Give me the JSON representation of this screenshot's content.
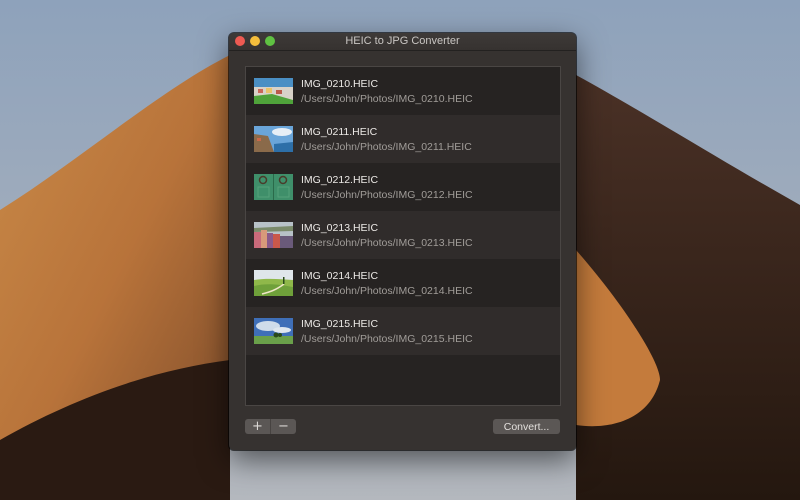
{
  "window": {
    "title": "HEIC to JPG Converter"
  },
  "files": [
    {
      "name": "IMG_0210.HEIC",
      "path": "/Users/John/Photos/IMG_0210.HEIC",
      "thumb": "coastal-village"
    },
    {
      "name": "IMG_0211.HEIC",
      "path": "/Users/John/Photos/IMG_0211.HEIC",
      "thumb": "cliff-sea"
    },
    {
      "name": "IMG_0212.HEIC",
      "path": "/Users/John/Photos/IMG_0212.HEIC",
      "thumb": "green-door"
    },
    {
      "name": "IMG_0213.HEIC",
      "path": "/Users/John/Photos/IMG_0213.HEIC",
      "thumb": "colorful-houses"
    },
    {
      "name": "IMG_0214.HEIC",
      "path": "/Users/John/Photos/IMG_0214.HEIC",
      "thumb": "green-hills"
    },
    {
      "name": "IMG_0215.HEIC",
      "path": "/Users/John/Photos/IMG_0215.HEIC",
      "thumb": "sky-field"
    }
  ],
  "toolbar": {
    "add_label": "+",
    "remove_label": "−",
    "convert_label": "Convert..."
  }
}
